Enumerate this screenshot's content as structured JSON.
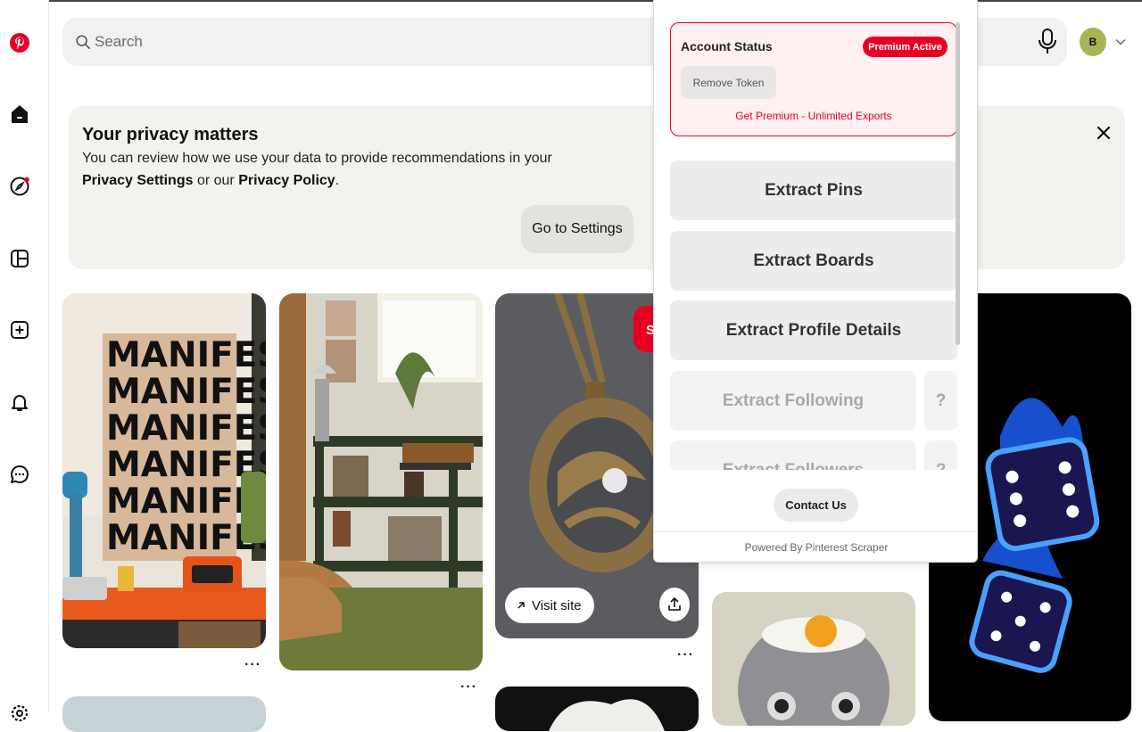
{
  "search": {
    "placeholder": "Search"
  },
  "user": {
    "avatar_initial": "B"
  },
  "privacy": {
    "title": "Your privacy matters",
    "line1": "You can review how we use your data to provide recommendations in your",
    "link_settings": "Privacy Settings",
    "or_our": " or our ",
    "link_policy": "Privacy Policy",
    "period": ".",
    "button": "Go to Settings"
  },
  "pins": {
    "manifest_text": "MANIFEST",
    "visit_site": "Visit site",
    "save_letter": "S",
    "more": "···"
  },
  "extension": {
    "account_status": "Account Status",
    "badge": "Premium Active",
    "remove_token": "Remove Token",
    "get_premium": "Get Premium - Unlimited Exports",
    "buttons": {
      "extract_pins": "Extract Pins",
      "extract_boards": "Extract Boards",
      "extract_profile": "Extract Profile Details",
      "extract_following": "Extract Following",
      "extract_followers": "Extract Followers",
      "help": "?"
    },
    "contact": "Contact Us",
    "powered_by": "Powered By Pinterest Scraper"
  },
  "colors": {
    "brand_red": "#e60023",
    "avatar": "#a9b458"
  }
}
